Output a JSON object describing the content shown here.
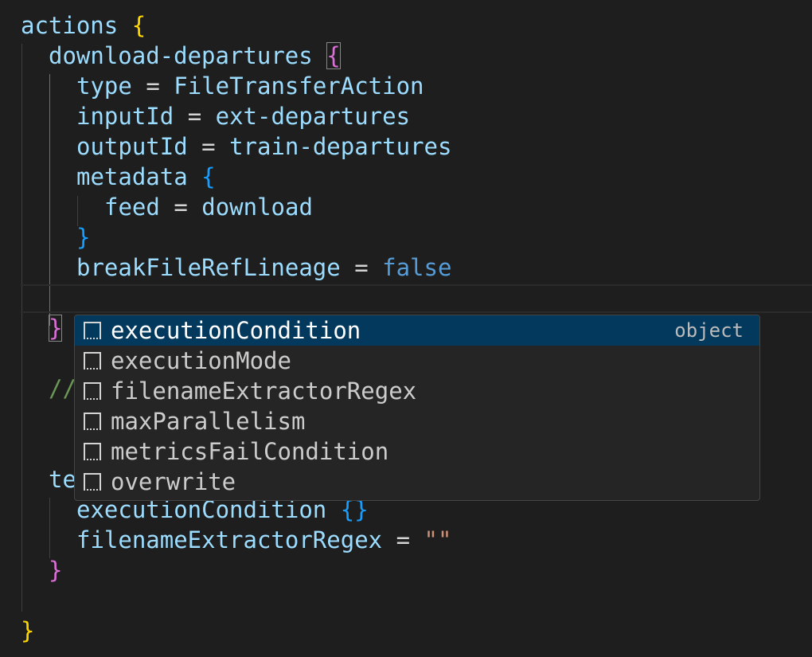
{
  "editor": {
    "l1_key": "actions",
    "l2_key": "download-departures",
    "l3_key": "type",
    "l3_val": "FileTransferAction",
    "l4_key": "inputId",
    "l4_val": "ext-departures",
    "l5_key": "outputId",
    "l5_val": "train-departures",
    "l6_key": "metadata",
    "l7_key": "feed",
    "l7_val": "download",
    "l9_key": "breakFileRefLineage",
    "l9_val": "false",
    "comment_partial": "//",
    "te_partial": "te",
    "l17_key": "executionCondition",
    "l18_key": "filenameExtractorRegex",
    "l18_val": "\"\"",
    "eq": "=",
    "ob": "{",
    "cb": "}",
    "empty_obj": "{}"
  },
  "suggest": {
    "items": [
      {
        "label": "executionCondition",
        "detail": "object"
      },
      {
        "label": "executionMode"
      },
      {
        "label": "filenameExtractorRegex"
      },
      {
        "label": "maxParallelism"
      },
      {
        "label": "metricsFailCondition"
      },
      {
        "label": "overwrite"
      }
    ],
    "icon": "property-icon",
    "selected_index": 0
  },
  "colors": {
    "background": "#1e1e1e",
    "selection": "#04395e",
    "bracket_level1": "#ffd700",
    "bracket_level2": "#da70d6",
    "bracket_level3": "#179fff"
  }
}
